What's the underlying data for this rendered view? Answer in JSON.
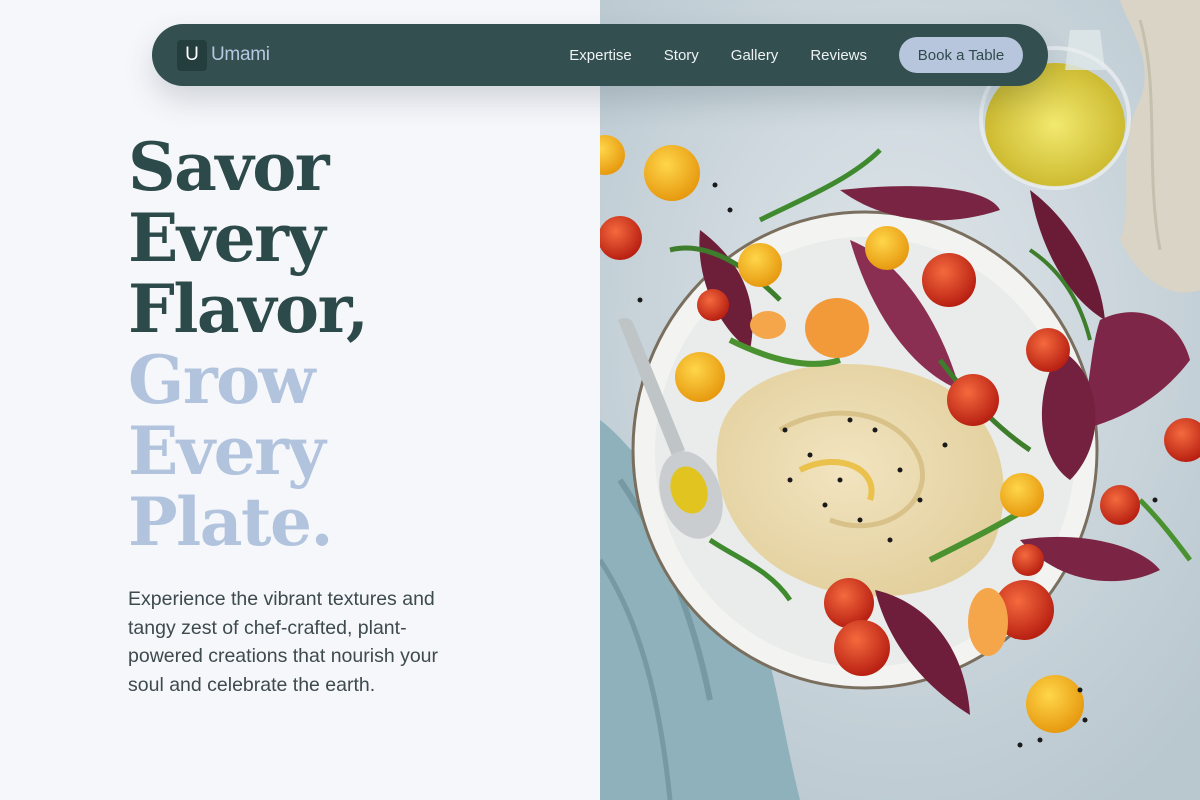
{
  "brand": {
    "mark": "U",
    "name": "Umami"
  },
  "nav": {
    "links": [
      "Expertise",
      "Story",
      "Gallery",
      "Reviews"
    ],
    "cta": "Book a Table"
  },
  "hero": {
    "headline_dark": [
      "Savor",
      "Every",
      "Flavor,"
    ],
    "headline_light": [
      "Grow",
      "Every",
      "Plate."
    ],
    "intro": "Experience the vibrant textures and tangy zest of chef-crafted, plant-powered creations that nourish your soul and celebrate the earth."
  },
  "colors": {
    "nav_bg": "#334f4f",
    "accent_light": "#b2c4dd",
    "headline_dark": "#2d4a4a",
    "page_bg": "#f6f7fb"
  },
  "image": {
    "subject": "hummus-salad-plate-photo"
  }
}
